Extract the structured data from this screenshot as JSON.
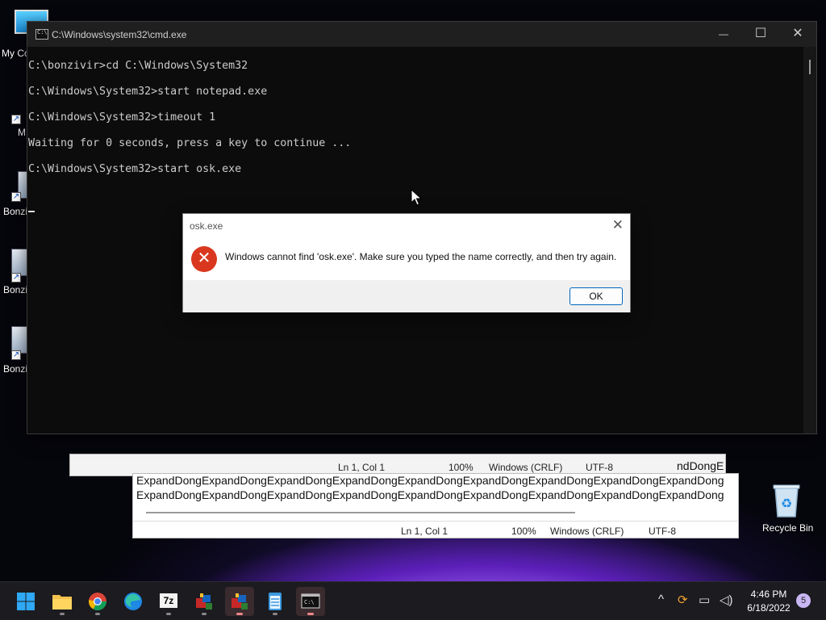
{
  "desktop": {
    "icons": [
      {
        "name": "my-computer",
        "label": "My Co"
      },
      {
        "name": "shortcut-m",
        "label": "M"
      },
      {
        "name": "bonzi-1",
        "label": "Bonzi"
      },
      {
        "name": "bonzi-2",
        "label": "Bonzi"
      },
      {
        "name": "bonzi-3",
        "label": "Bonzi"
      }
    ],
    "recycle_bin_label": "Recycle Bin"
  },
  "notepad_back": {
    "text_rows": [
      "ExpandDongExpandDongExpandDongExpandDongExpandDongExpandDongExpandDongExpandDongExpandDongE",
      "ExpandDongExpandDongExpandDongExpandDongExpandDongExpandDongExpandDongExpandDongExpandDongE"
    ],
    "side_text": "ndDongE",
    "status": {
      "position": "Ln 1, Col 1",
      "zoom": "100%",
      "line_ending": "Windows (CRLF)",
      "encoding": "UTF-8"
    }
  },
  "cmd": {
    "title": "C:\\Windows\\system32\\cmd.exe",
    "lines": [
      "C:\\bonzivir>cd C:\\Windows\\System32",
      "C:\\Windows\\System32>start notepad.exe",
      "C:\\Windows\\System32>timeout 1",
      "Waiting for 0 seconds, press a key to continue ...",
      "C:\\Windows\\System32>start osk.exe"
    ],
    "controls": {
      "minimize": "—",
      "maximize": "☐",
      "close": "✕"
    }
  },
  "dialog": {
    "title": "osk.exe",
    "message": "Windows cannot find 'osk.exe'. Make sure you typed the name correctly, and then try again.",
    "ok_label": "OK",
    "close_glyph": "✕"
  },
  "taskbar": {
    "apps": [
      {
        "name": "start-button",
        "icon": "windows-logo-icon"
      },
      {
        "name": "file-explorer",
        "icon": "folder-icon"
      },
      {
        "name": "chrome",
        "icon": "chrome-icon"
      },
      {
        "name": "edge",
        "icon": "edge-icon"
      },
      {
        "name": "7zip",
        "icon": "7zip-icon",
        "label": "7z"
      },
      {
        "name": "bonzi-app-1",
        "icon": "bonzi-icon"
      },
      {
        "name": "bonzi-app-2",
        "icon": "bonzi-icon"
      },
      {
        "name": "notepad",
        "icon": "notepad-icon"
      },
      {
        "name": "cmd",
        "icon": "terminal-icon"
      }
    ],
    "tray": {
      "time": "4:46 PM",
      "date": "6/18/2022",
      "notification_count": "5"
    }
  },
  "colors": {
    "cmd_background": "#0c0c0c",
    "cmd_text": "#cccccc",
    "error_red": "#d9381e",
    "accent_blue": "#0067c0"
  }
}
